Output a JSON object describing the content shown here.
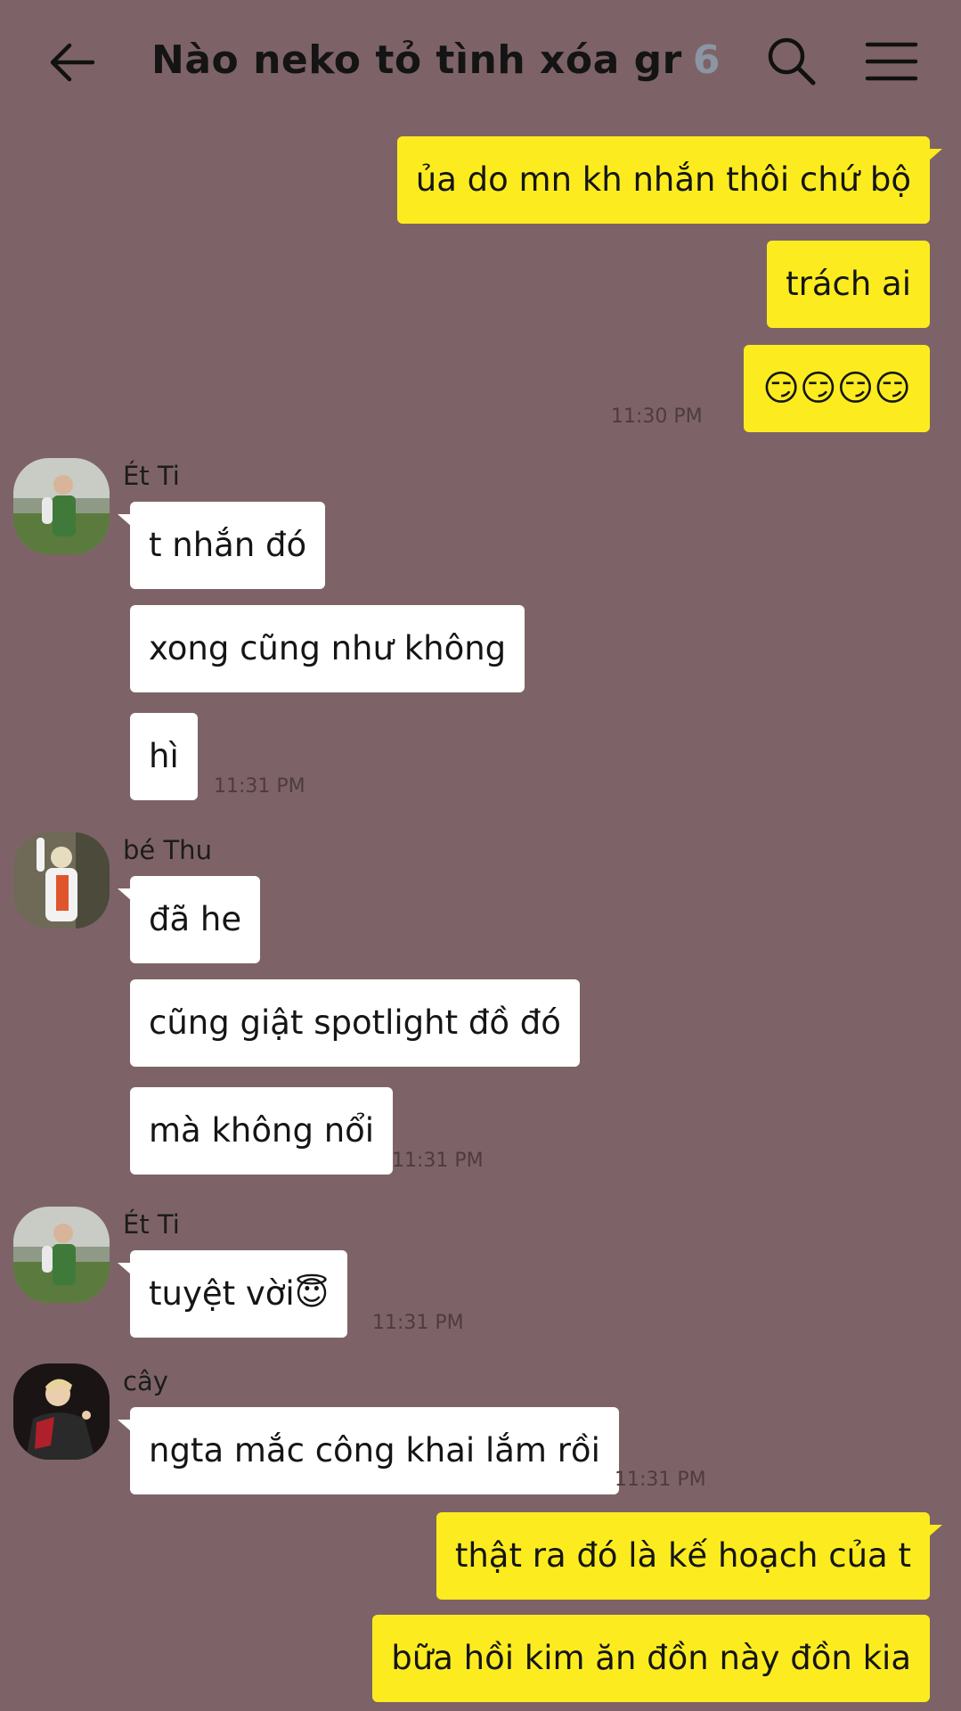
{
  "header": {
    "title": "Nào neko tỏ tình xóa gr",
    "member_count": "6",
    "back_icon": "arrow-left-icon",
    "search_icon": "search-icon",
    "menu_icon": "hamburger-menu-icon"
  },
  "colors": {
    "background": "#7d6367",
    "my_bubble": "#fcec1f",
    "their_bubble": "#ffffff",
    "member_count": "#8a96a4"
  },
  "messages": {
    "m1": "ủa do mn kh nhắn thôi chứ bộ",
    "m2": "trách ai",
    "m3": "😏😏😏😏",
    "m3_time": "11:30 PM",
    "g1_sender": "Ét Ti",
    "m4": "t nhắn đó",
    "m5": "xong cũng như không",
    "m6": "hì",
    "m6_time": "11:31 PM",
    "g2_sender": "bé Thu",
    "m7": "đã he",
    "m8": "cũng giật spotlight đồ đó",
    "m9": "mà không nổi",
    "m9_time": "11:31 PM",
    "g3_sender": "Ét Ti",
    "m10": "tuyệt vời😇",
    "m10_time": "11:31 PM",
    "g4_sender": "cây",
    "m11": "ngta mắc công khai lắm rồi",
    "m11_time": "11:31 PM",
    "m12": "thật ra đó là kế hoạch của t",
    "m13": "bữa hồi kim ăn đồn này đồn kia"
  }
}
